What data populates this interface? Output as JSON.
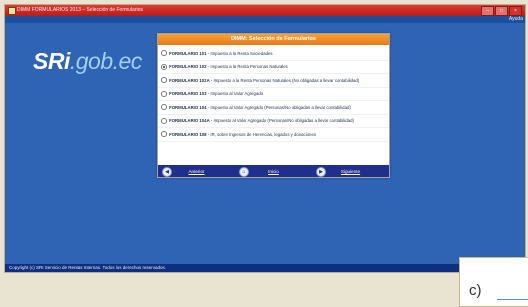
{
  "window": {
    "title": "DIMM FORMULARIOS 2013 – Selección de Formularios",
    "help": "Ayuda"
  },
  "logo": {
    "part1": "SRi",
    "part2": ".gob.ec"
  },
  "dialog": {
    "title": "DIMM: Selección de Formularios",
    "forms": [
      {
        "label": "FORMULARIO 101",
        "desc": "- Impuesto a la Renta  Sociedades",
        "selected": false
      },
      {
        "label": "FORMULARIO 102",
        "desc": "- Impuesto a la Renta  Personas Naturales",
        "selected": true
      },
      {
        "label": "FORMULARIO 102A",
        "desc": "- Impuesto a la Renta  Personas Naturales (No obligadas a llevar contabilidad)",
        "selected": false
      },
      {
        "label": "FORMULARIO 103",
        "desc": "- Impuesto al Valor Agregado",
        "selected": false
      },
      {
        "label": "FORMULARIO 104",
        "desc": "- Impuesto al Valor Agregado (Personas/No obligadas a llevar contabilidad)",
        "selected": false
      },
      {
        "label": "FORMULARIO 104A",
        "desc": "- Impuesto al Valor Agregado (Personas/No obligadas a llevar contabilidad)",
        "selected": false
      },
      {
        "label": "FORMULARIO 108",
        "desc": "- IR, sobre Ingresos de Herencias, legados y donaciones",
        "selected": false
      }
    ],
    "buttons": {
      "back": "Anterior",
      "home": "Inicio",
      "next": "Siguiente"
    }
  },
  "status_bar": {
    "text": "Copyright (c) SRI Servicio de Rentas Internas. Todos los derechos reservados."
  },
  "corner_label": "c)"
}
